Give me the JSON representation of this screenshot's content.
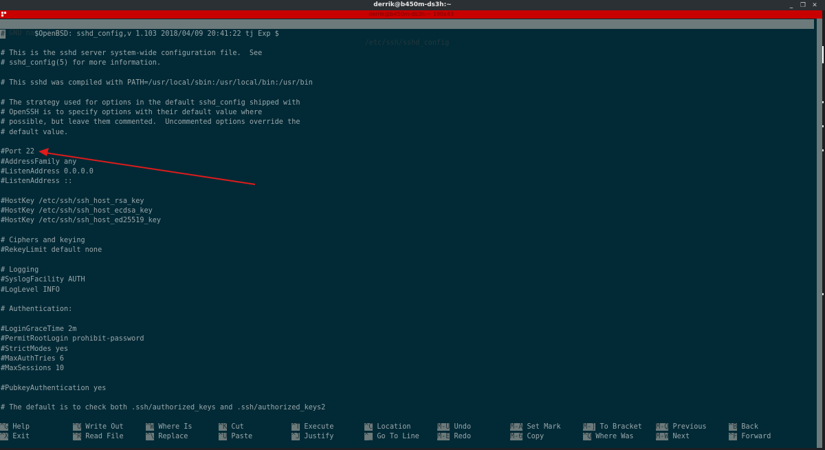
{
  "window": {
    "title": "derrik@b450m-ds3h:~",
    "tab_title": "derrik@b450m-ds3h:~ 190x43",
    "controls": {
      "minimize": "_",
      "maximize": "❐",
      "close": "✕"
    }
  },
  "nano": {
    "version": "GNU nano 5.4",
    "filename": "/etc/ssh/sshd_config",
    "cursor_char": "#",
    "lines": [
      "       $OpenBSD: sshd_config,v 1.103 2018/04/09 20:41:22 tj Exp $",
      "",
      "# This is the sshd server system-wide configuration file.  See",
      "# sshd_config(5) for more information.",
      "",
      "# This sshd was compiled with PATH=/usr/local/sbin:/usr/local/bin:/usr/bin",
      "",
      "# The strategy used for options in the default sshd_config shipped with",
      "# OpenSSH is to specify options with their default value where",
      "# possible, but leave them commented.  Uncommented options override the",
      "# default value.",
      "",
      "#Port 22",
      "#AddressFamily any",
      "#ListenAddress 0.0.0.0",
      "#ListenAddress ::",
      "",
      "#HostKey /etc/ssh/ssh_host_rsa_key",
      "#HostKey /etc/ssh/ssh_host_ecdsa_key",
      "#HostKey /etc/ssh/ssh_host_ed25519_key",
      "",
      "# Ciphers and keying",
      "#RekeyLimit default none",
      "",
      "# Logging",
      "#SyslogFacility AUTH",
      "#LogLevel INFO",
      "",
      "# Authentication:",
      "",
      "#LoginGraceTime 2m",
      "#PermitRootLogin prohibit-password",
      "#StrictModes yes",
      "#MaxAuthTries 6",
      "#MaxSessions 10",
      "",
      "#PubkeyAuthentication yes",
      "",
      "# The default is to check both .ssh/authorized_keys and .ssh/authorized_keys2"
    ],
    "shortcuts": [
      {
        "key": "^G",
        "label": "Help"
      },
      {
        "key": "^X",
        "label": "Exit"
      },
      {
        "key": "^O",
        "label": "Write Out"
      },
      {
        "key": "^R",
        "label": "Read File"
      },
      {
        "key": "^W",
        "label": "Where Is"
      },
      {
        "key": "^\\",
        "label": "Replace"
      },
      {
        "key": "^K",
        "label": "Cut"
      },
      {
        "key": "^U",
        "label": "Paste"
      },
      {
        "key": "^T",
        "label": "Execute"
      },
      {
        "key": "^J",
        "label": "Justify"
      },
      {
        "key": "^C",
        "label": "Location"
      },
      {
        "key": "^_",
        "label": "Go To Line"
      },
      {
        "key": "M-U",
        "label": "Undo"
      },
      {
        "key": "M-E",
        "label": "Redo"
      },
      {
        "key": "M-A",
        "label": "Set Mark"
      },
      {
        "key": "M-6",
        "label": "Copy"
      },
      {
        "key": "M-]",
        "label": "To Bracket"
      },
      {
        "key": "^Q",
        "label": "Where Was"
      },
      {
        "key": "M-Q",
        "label": "Previous"
      },
      {
        "key": "M-W",
        "label": "Next"
      },
      {
        "key": "^B",
        "label": "Back"
      },
      {
        "key": "^F",
        "label": "Forward"
      }
    ]
  },
  "annotation": {
    "type": "arrow",
    "color": "#e01b1b",
    "points_to": "#Port 22"
  },
  "colors": {
    "terminal_bg": "#012a36",
    "tab_accent": "#c80000",
    "text": "#9aa6aa",
    "highlight": "#6c7a7b"
  }
}
